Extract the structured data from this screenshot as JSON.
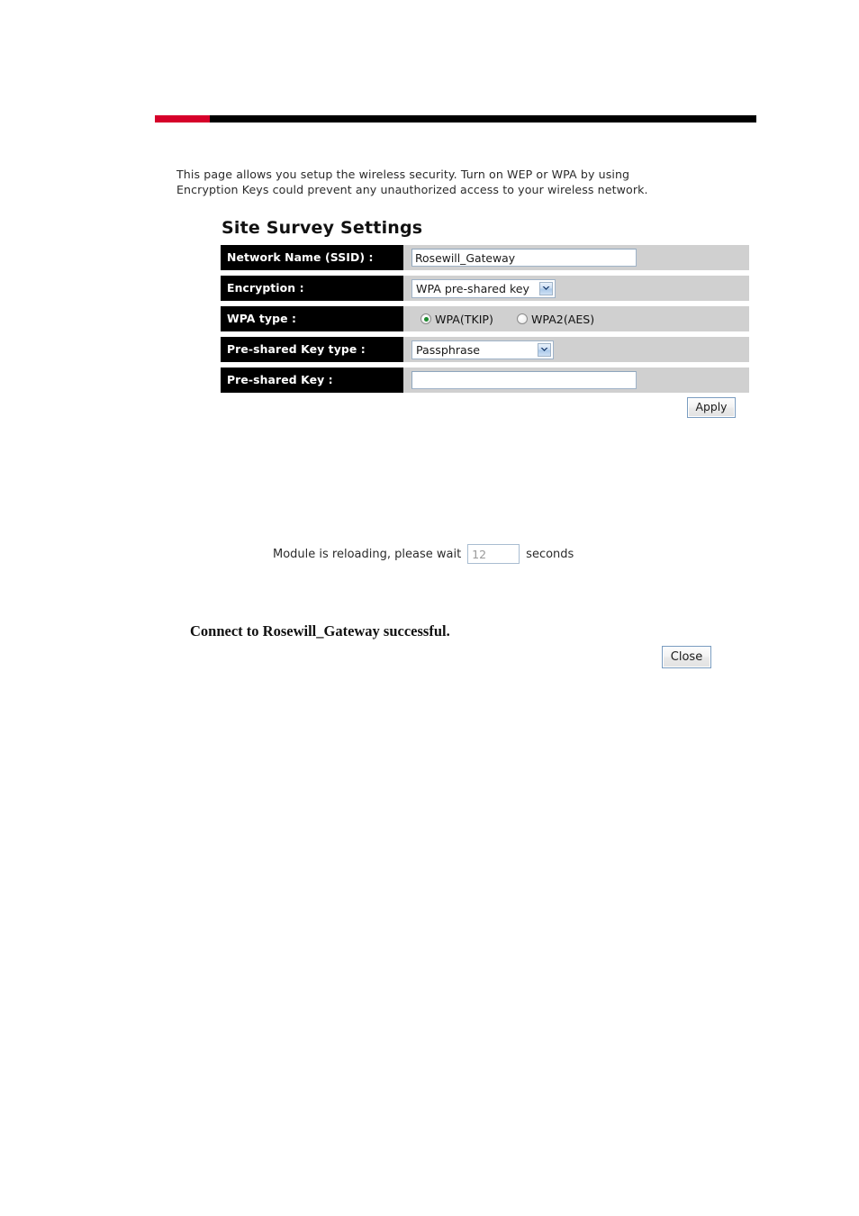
{
  "page": {
    "intro_line_1": "This page allows you setup the wireless security. Turn on WEP or WPA by using",
    "intro_line_2": "Encryption Keys could prevent any unauthorized access to your wireless network.",
    "section_title": "Site Survey Settings"
  },
  "theme": {
    "accent_red": "#d6002a",
    "rule_black": "#000000",
    "row_label_bg": "#000000",
    "row_field_bg": "#d0d0d0",
    "radio_selected_dot": "#1d8a2e"
  },
  "form": {
    "rows": [
      {
        "label": "Network Name (SSID) :",
        "type": "text",
        "value": "Rosewill_Gateway",
        "placeholder": ""
      },
      {
        "label": "Encryption :",
        "type": "select",
        "value": "WPA pre-shared key"
      },
      {
        "label": "WPA type :",
        "type": "radio",
        "value": "WPA(TKIP)"
      },
      {
        "label": "Pre-shared Key type :",
        "type": "select",
        "value": "Passphrase"
      },
      {
        "label": "Pre-shared Key :",
        "type": "text",
        "value": "",
        "placeholder": ""
      }
    ],
    "encryption_options": [
      "WPA pre-shared key"
    ],
    "pre_shared_key_type_options": [
      "Passphrase"
    ],
    "wpa_type_options": [
      {
        "label": "WPA(TKIP)",
        "selected": true
      },
      {
        "label": "WPA2(AES)",
        "selected": false
      }
    ],
    "apply_label": "Apply"
  },
  "status": {
    "reload_prefix": "Module is reloading, please wait",
    "reload_seconds": "12",
    "reload_suffix": "seconds",
    "success_message": "Connect to Rosewill_Gateway successful.",
    "close_label": "Close"
  },
  "icons": {
    "dropdown": "chevron-down-icon"
  }
}
